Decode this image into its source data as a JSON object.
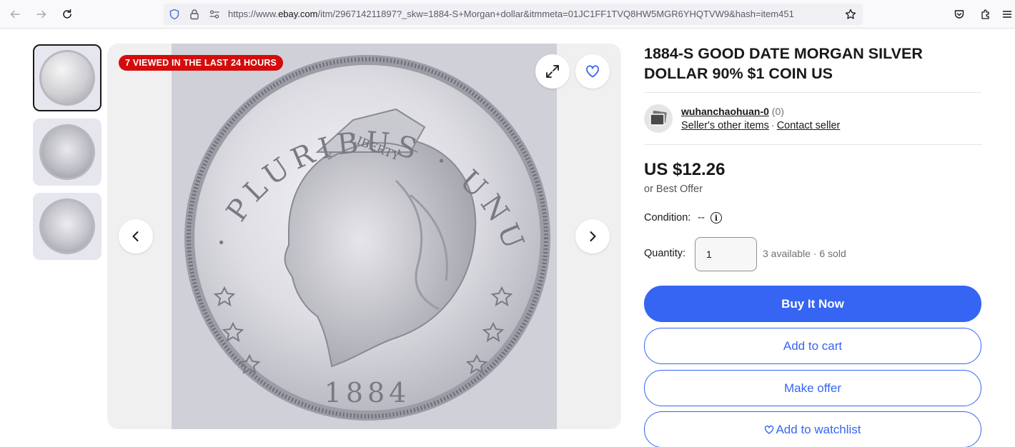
{
  "browser": {
    "url_prefix": "https://www.",
    "url_domain": "ebay.com",
    "url_rest": "/itm/296714211897?_skw=1884-S+Morgan+dollar&itmmeta=01JC1FF1TVQ8HW5MGR6YHQTVW9&hash=item451"
  },
  "gallery": {
    "badge": "7 VIEWED IN THE LAST 24 HOURS"
  },
  "coin": {
    "legend": "E · PLURIBUS · UNUM",
    "band": "LIBERTY",
    "year": "1884"
  },
  "listing": {
    "title": "1884-S GOOD DATE MORGAN SILVER DOLLAR 90% $1 COIN US",
    "seller_name": "wuhanchaohuan-0",
    "seller_feedback": "(0)",
    "seller_other_items": "Seller's other items",
    "contact_seller": "Contact seller",
    "dot": "·",
    "price": "US $12.26",
    "best_offer": "or Best Offer",
    "condition_label": "Condition:",
    "condition_value": "--",
    "quantity_label": "Quantity:",
    "quantity_value": "1",
    "availability": "3 available · 6 sold"
  },
  "actions": {
    "buy_now": "Buy It Now",
    "add_to_cart": "Add to cart",
    "make_offer": "Make offer",
    "add_to_watchlist": "Add to watchlist"
  },
  "colors": {
    "primary": "#3665f3",
    "badge": "#d50b0b",
    "text": "#191919"
  }
}
